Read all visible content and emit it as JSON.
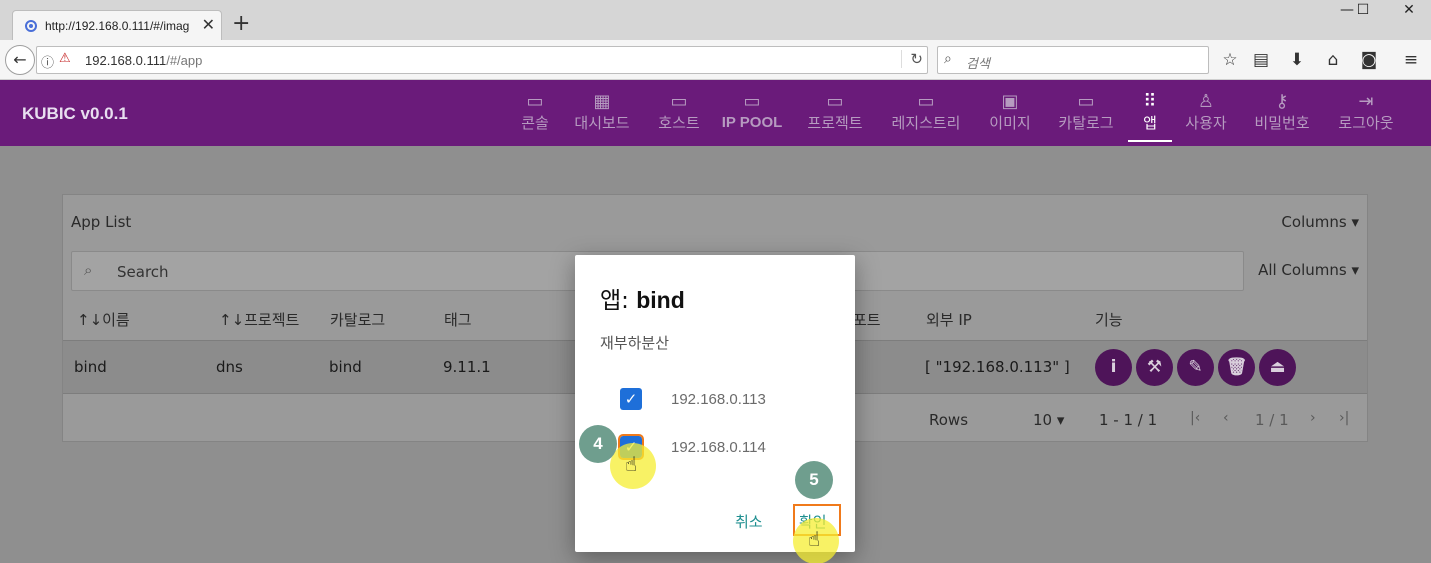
{
  "browser": {
    "tab_title": "http://192.168.0.111/#/imag",
    "url_host": "192.168.0.111",
    "url_path": "/#/app",
    "search_placeholder": "검색"
  },
  "app": {
    "brand": "KUBIC v0.0.1",
    "nav": [
      {
        "label": "콘솔",
        "icon": "laptop-icon"
      },
      {
        "label": "대시보드",
        "icon": "dashboard-icon"
      },
      {
        "label": "호스트",
        "icon": "laptop-icon"
      },
      {
        "label": "IP POOL",
        "icon": "laptop-icon"
      },
      {
        "label": "프로젝트",
        "icon": "laptop-icon"
      },
      {
        "label": "레지스트리",
        "icon": "laptop-icon"
      },
      {
        "label": "이미지",
        "icon": "image-icon"
      },
      {
        "label": "카탈로그",
        "icon": "laptop-icon"
      },
      {
        "label": "앱",
        "icon": "apps-grid-icon"
      },
      {
        "label": "사용자",
        "icon": "person-icon"
      },
      {
        "label": "비밀번호",
        "icon": "key-icon"
      },
      {
        "label": "로그아웃",
        "icon": "logout-icon"
      }
    ]
  },
  "table": {
    "title": "App List",
    "columns_button": "Columns",
    "all_columns_button": "All Columns",
    "search_placeholder": "Search",
    "headers": [
      "↑↓이름",
      "↑↓프로젝트",
      "카탈로그",
      "태그",
      "포트",
      "외부 IP",
      "기능"
    ],
    "rows": [
      {
        "name": "bind",
        "project": "dns",
        "catalog": "bind",
        "tag": "9.11.1",
        "external_ip": "[ \"192.168.0.113\" ]"
      }
    ],
    "pager": {
      "rows_label": "Rows",
      "rows_value": "10",
      "range": "1 - 1 / 1",
      "page": "1 / 1"
    }
  },
  "dialog": {
    "title_prefix": "앱:",
    "title_name": "bind",
    "subtitle": "재부하분산",
    "options": [
      {
        "label": "192.168.0.113",
        "checked": true
      },
      {
        "label": "192.168.0.114",
        "checked": true
      }
    ],
    "cancel": "취소",
    "confirm": "확인"
  },
  "annotations": {
    "step4": "4",
    "step5": "5"
  },
  "colors": {
    "brand": "#6a1b7a",
    "checkbox": "#1e6fd9",
    "button_text": "#1f8f90",
    "highlight": "#f07a1b"
  }
}
